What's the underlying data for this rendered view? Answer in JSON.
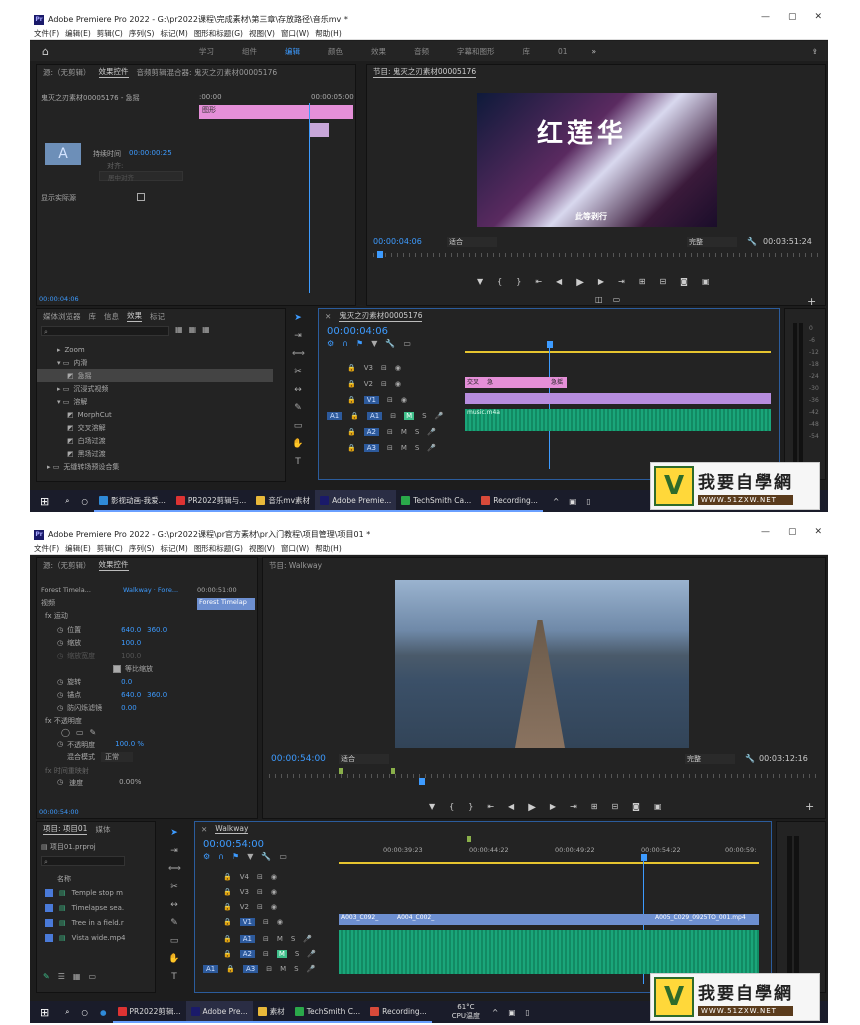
{
  "top": {
    "title": "Adobe Premiere Pro 2022 - G:\\pr2022课程\\完成素材\\第三章\\存放路径\\音乐mv *",
    "menus": [
      "文件(F)",
      "编辑(E)",
      "剪辑(C)",
      "序列(S)",
      "标记(M)",
      "图形和标题(G)",
      "视图(V)",
      "窗口(W)",
      "帮助(H)"
    ],
    "workspaces": [
      "学习",
      "组件",
      "编辑",
      "颜色",
      "效果",
      "音频",
      "字幕和图形",
      "库",
      "01"
    ],
    "active_workspace": "编辑",
    "src_tabs": [
      "源:（无剪辑）",
      "效果控件",
      "音频剪辑混合器: 鬼灭之刃素材00005176"
    ],
    "ec_clip": "鬼灭之刃素材00005176 - 急摇",
    "ec_time_a": ":00:00",
    "ec_time_b": "00:00:05:00",
    "ec_graphic": "图形",
    "ec_duration_label": "持续时间",
    "ec_duration": "00:00:00:25",
    "ec_align": "对齐:",
    "ec_align_val": "居中对齐",
    "ec_show_src": "显示实际源",
    "ec_time_bottom": "00:00:04:06",
    "program_title": "节目: 鬼灭之刃素材00005176",
    "video_text": "红莲华",
    "video_sub": "此等剥行",
    "prog_time": "00:00:04:06",
    "prog_fit": "适合",
    "prog_quality": "完整",
    "prog_dur": "00:03:51:24",
    "proj_tabs": [
      "媒体浏览器",
      "库",
      "信息",
      "效果",
      "标记"
    ],
    "effects_tree": [
      "Zoom",
      "内滑",
      "急摇",
      "沉浸式视频",
      "溶解",
      "MorphCut",
      "交叉溶解",
      "白场过渡",
      "黑场过渡",
      "无缝转场预设合集"
    ],
    "seq_tab": "鬼灭之刃素材00005176",
    "seq_time": "00:00:04:06",
    "tracks": [
      "V3",
      "V2",
      "V1",
      "A1",
      "A2",
      "A3"
    ],
    "clip_v2a": "交叉",
    "clip_v2b": "急",
    "clip_v2c": "急摇",
    "clip_a1": "music.m4a",
    "meter_scale": [
      "0",
      "-6",
      "-12",
      "-18",
      "-24",
      "-30",
      "-36",
      "-42",
      "-48",
      "-54"
    ],
    "taskbar": [
      "影视动画-我爱...",
      "PR2022剪辑与...",
      "音乐mv素材",
      "Adobe Premie...",
      "TechSmith Ca...",
      "Recording..."
    ]
  },
  "bottom": {
    "title": "Adobe Premiere Pro 2022 - G:\\pr2022课程\\pr官方素材\\pr入门教程\\项目管理\\项目01 *",
    "menus": [
      "文件(F)",
      "编辑(E)",
      "剪辑(C)",
      "序列(S)",
      "标记(M)",
      "图形和标题(G)",
      "视图(V)",
      "窗口(W)",
      "帮助(H)"
    ],
    "src_tabs": [
      "源:（无剪辑）",
      "效果控件"
    ],
    "ec_clip": "Forest Timela...",
    "ec_seq": "Walkway · Fore...",
    "ec_time": "00:00:51:00",
    "ec_clip_label": "Forest Timelap",
    "ec_video": "视频",
    "ec_motion": "运动",
    "ec_props": [
      {
        "name": "位置",
        "v1": "640.0",
        "v2": "360.0"
      },
      {
        "name": "缩放",
        "v1": "100.0",
        "v2": ""
      },
      {
        "name": "缩放宽度",
        "v1": "100.0",
        "v2": ""
      },
      {
        "name": "等比缩放",
        "v1": "",
        "v2": ""
      },
      {
        "name": "旋转",
        "v1": "0.0",
        "v2": ""
      },
      {
        "name": "锚点",
        "v1": "640.0",
        "v2": "360.0"
      },
      {
        "name": "防闪烁滤镜",
        "v1": "0.00",
        "v2": ""
      }
    ],
    "ec_opacity": "不透明度",
    "ec_opacity_val": "100.0 %",
    "ec_blend": "混合模式",
    "ec_blend_val": "正常",
    "ec_timeremap": "时间重映射",
    "ec_speed": "速度",
    "ec_speed_val": "0.00%",
    "ec_time_bottom": "00:00:54:00",
    "program_title": "节目: Walkway",
    "prog_time": "00:00:54:00",
    "prog_fit": "适合",
    "prog_quality": "完整",
    "prog_dur": "00:03:12:16",
    "proj_tabs": [
      "项目: 项目01",
      "媒体"
    ],
    "proj_file": "项目01.prproj",
    "proj_col": "名称",
    "proj_items": [
      "Temple stop m",
      "Timelapse sea.",
      "Tree in a field.r",
      "Vista wide.mp4"
    ],
    "seq_tab": "Walkway",
    "seq_time": "00:00:54:00",
    "ruler": [
      "00:00:39:23",
      "00:00:44:22",
      "00:00:49:22",
      "00:00:54:22",
      "00:00:59:"
    ],
    "tracks": [
      "V4",
      "V3",
      "V2",
      "V1",
      "A1",
      "A2",
      "A3"
    ],
    "clip_v1a": "A003_C092_",
    "clip_v1b": "A004_C002_",
    "clip_v1c": "A005_C029_0925TO_001.mp4",
    "taskbar": [
      "PR2022剪辑...",
      "Adobe Pre...",
      "素材",
      "TechSmith C...",
      "Recording..."
    ],
    "temp": "61°C",
    "temp_label": "CPU温度"
  },
  "watermark": {
    "cn": "我要自學網",
    "url": "WWW.51ZXW.NET"
  }
}
